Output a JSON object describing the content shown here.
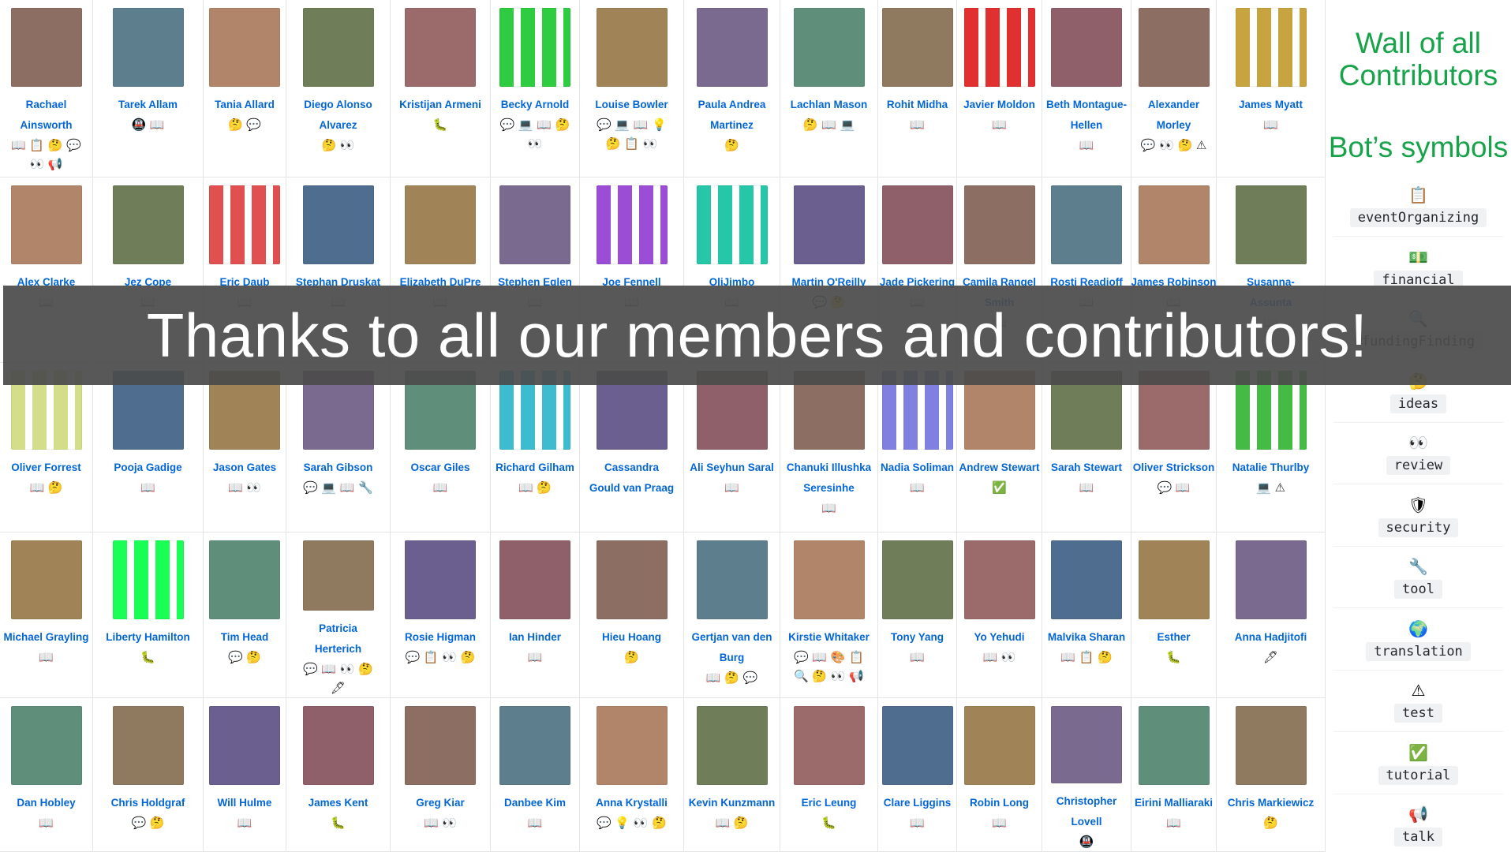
{
  "panel": {
    "title": "Wall of all Contributors",
    "subtitle": "Bot’s symbols",
    "symbols": [
      {
        "icon": "clipboard-icon",
        "glyph": "📋",
        "label": "eventOrganizing"
      },
      {
        "icon": "dollar-banknote-icon",
        "glyph": "💵",
        "label": "financial"
      },
      {
        "icon": "magnifier-icon",
        "glyph": "🔍",
        "label": "fundingFinding"
      },
      {
        "icon": "thinking-face-icon",
        "glyph": "🤔",
        "label": "ideas"
      },
      {
        "icon": "eyes-icon",
        "glyph": "👀",
        "label": "review"
      },
      {
        "icon": "shield-icon",
        "glyph": "🛡",
        "label": "security"
      },
      {
        "icon": "wrench-icon",
        "glyph": "🔧",
        "label": "tool"
      },
      {
        "icon": "globe-icon",
        "glyph": "🌍",
        "label": "translation"
      },
      {
        "icon": "warning-icon",
        "glyph": "⚠",
        "label": "test"
      },
      {
        "icon": "check-mark-icon",
        "glyph": "✅",
        "label": "tutorial"
      },
      {
        "icon": "megaphone-icon",
        "glyph": "📢",
        "label": "talk"
      }
    ]
  },
  "banner": {
    "text": "Thanks to all our members and contributors!"
  },
  "colors": {
    "accent_green": "#17a34a",
    "link_blue": "#0366d6",
    "banner_bg": "#4b4b4b"
  },
  "contributors": [
    {
      "name": "Rachael Ainsworth",
      "emojis": "📖 📋 🤔 💬 👀 📢"
    },
    {
      "name": "Tarek Allam",
      "emojis": "🚇 📖"
    },
    {
      "name": "Tania Allard",
      "emojis": "🤔 💬"
    },
    {
      "name": "Diego Alonso Alvarez",
      "emojis": "🤔 👀"
    },
    {
      "name": "Kristijan Armeni",
      "emojis": "🐛"
    },
    {
      "name": "Becky Arnold",
      "emojis": "💬 💻 📖 🤔 👀"
    },
    {
      "name": "Louise Bowler",
      "emojis": "💬 💻 📖 💡 🤔 📋 👀"
    },
    {
      "name": "Paula Andrea Martinez",
      "emojis": "🤔"
    },
    {
      "name": "Lachlan Mason",
      "emojis": "🤔 📖 💻"
    },
    {
      "name": "Rohit Midha",
      "emojis": "📖"
    },
    {
      "name": "Javier Moldon",
      "emojis": "📖"
    },
    {
      "name": "Beth Montague-Hellen",
      "emojis": "📖"
    },
    {
      "name": "Alexander Morley",
      "emojis": "💬 👀 🤔 ⚠"
    },
    {
      "name": "James Myatt",
      "emojis": "📖"
    },
    {
      "name": "Alex Clarke",
      "emojis": "📖"
    },
    {
      "name": "Jez Cope",
      "emojis": "📖"
    },
    {
      "name": "Eric Daub",
      "emojis": "📖"
    },
    {
      "name": "Stephan Druskat",
      "emojis": "📖"
    },
    {
      "name": "Elizabeth DuPre",
      "emojis": "📖"
    },
    {
      "name": "Stephen Eglen",
      "emojis": "📖"
    },
    {
      "name": "Joe Fennell",
      "emojis": "📖"
    },
    {
      "name": "OliJimbo",
      "emojis": "📖"
    },
    {
      "name": "Martin O'Reilly",
      "emojis": "💬 🤔"
    },
    {
      "name": "Jade Pickering",
      "emojis": "📖"
    },
    {
      "name": "Camila Rangel Smith",
      "emojis": "📖"
    },
    {
      "name": "Rosti Readioff",
      "emojis": "📖"
    },
    {
      "name": "James Robinson",
      "emojis": "📖"
    },
    {
      "name": "Susanna-Assunta",
      "emojis": "📖"
    },
    {
      "name": "Oliver Forrest",
      "emojis": "📖 🤔"
    },
    {
      "name": "Pooja Gadige",
      "emojis": "📖"
    },
    {
      "name": "Jason Gates",
      "emojis": "📖 👀"
    },
    {
      "name": "Sarah Gibson",
      "emojis": "💬 💻 📖 🔧"
    },
    {
      "name": "Oscar Giles",
      "emojis": "📖"
    },
    {
      "name": "Richard Gilham",
      "emojis": "📖 🤔"
    },
    {
      "name": "Cassandra Gould van Praag",
      "emojis": ""
    },
    {
      "name": "Ali Seyhun Saral",
      "emojis": "📖"
    },
    {
      "name": "Chanuki Illushka Seresinhe",
      "emojis": "📖"
    },
    {
      "name": "Nadia Soliman",
      "emojis": "📖"
    },
    {
      "name": "Andrew Stewart",
      "emojis": "✅"
    },
    {
      "name": "Sarah Stewart",
      "emojis": "📖"
    },
    {
      "name": "Oliver Strickson",
      "emojis": "💬 📖"
    },
    {
      "name": "Natalie Thurlby",
      "emojis": "💻 ⚠"
    },
    {
      "name": "Michael Grayling",
      "emojis": "📖"
    },
    {
      "name": "Liberty Hamilton",
      "emojis": "🐛"
    },
    {
      "name": "Tim Head",
      "emojis": "💬 🤔"
    },
    {
      "name": "Patricia Herterich",
      "emojis": "💬 📖 👀 🤔 🖋"
    },
    {
      "name": "Rosie Higman",
      "emojis": "💬 📋 👀 🤔"
    },
    {
      "name": "Ian Hinder",
      "emojis": "📖"
    },
    {
      "name": "Hieu Hoang",
      "emojis": "🤔"
    },
    {
      "name": "Gertjan van den Burg",
      "emojis": "📖 🤔 💬"
    },
    {
      "name": "Kirstie Whitaker",
      "emojis": "💬 📖 🎨 📋 🔍 🤔 👀 📢"
    },
    {
      "name": "Tony Yang",
      "emojis": "📖"
    },
    {
      "name": "Yo Yehudi",
      "emojis": "📖 👀"
    },
    {
      "name": "Malvika Sharan",
      "emojis": "📖 📋 🤔"
    },
    {
      "name": "Esther",
      "emojis": "🐛"
    },
    {
      "name": "Anna Hadjitofi",
      "emojis": "🖋"
    },
    {
      "name": "Dan Hobley",
      "emojis": "📖"
    },
    {
      "name": "Chris Holdgraf",
      "emojis": "💬 🤔"
    },
    {
      "name": "Will Hulme",
      "emojis": "📖"
    },
    {
      "name": "James Kent",
      "emojis": "🐛"
    },
    {
      "name": "Greg Kiar",
      "emojis": "📖 👀"
    },
    {
      "name": "Danbee Kim",
      "emojis": "📖"
    },
    {
      "name": "Anna Krystalli",
      "emojis": "💬 💡 👀 🤔"
    },
    {
      "name": "Kevin Kunzmann",
      "emojis": "📖 🤔"
    },
    {
      "name": "Eric Leung",
      "emojis": "🐛"
    },
    {
      "name": "Clare Liggins",
      "emojis": "📖"
    },
    {
      "name": "Robin Long",
      "emojis": "📖"
    },
    {
      "name": "Christopher Lovell",
      "emojis": "🚇"
    },
    {
      "name": "Eirini Malliaraki",
      "emojis": "📖"
    },
    {
      "name": "Chris Markiewicz",
      "emojis": "🤔"
    }
  ]
}
